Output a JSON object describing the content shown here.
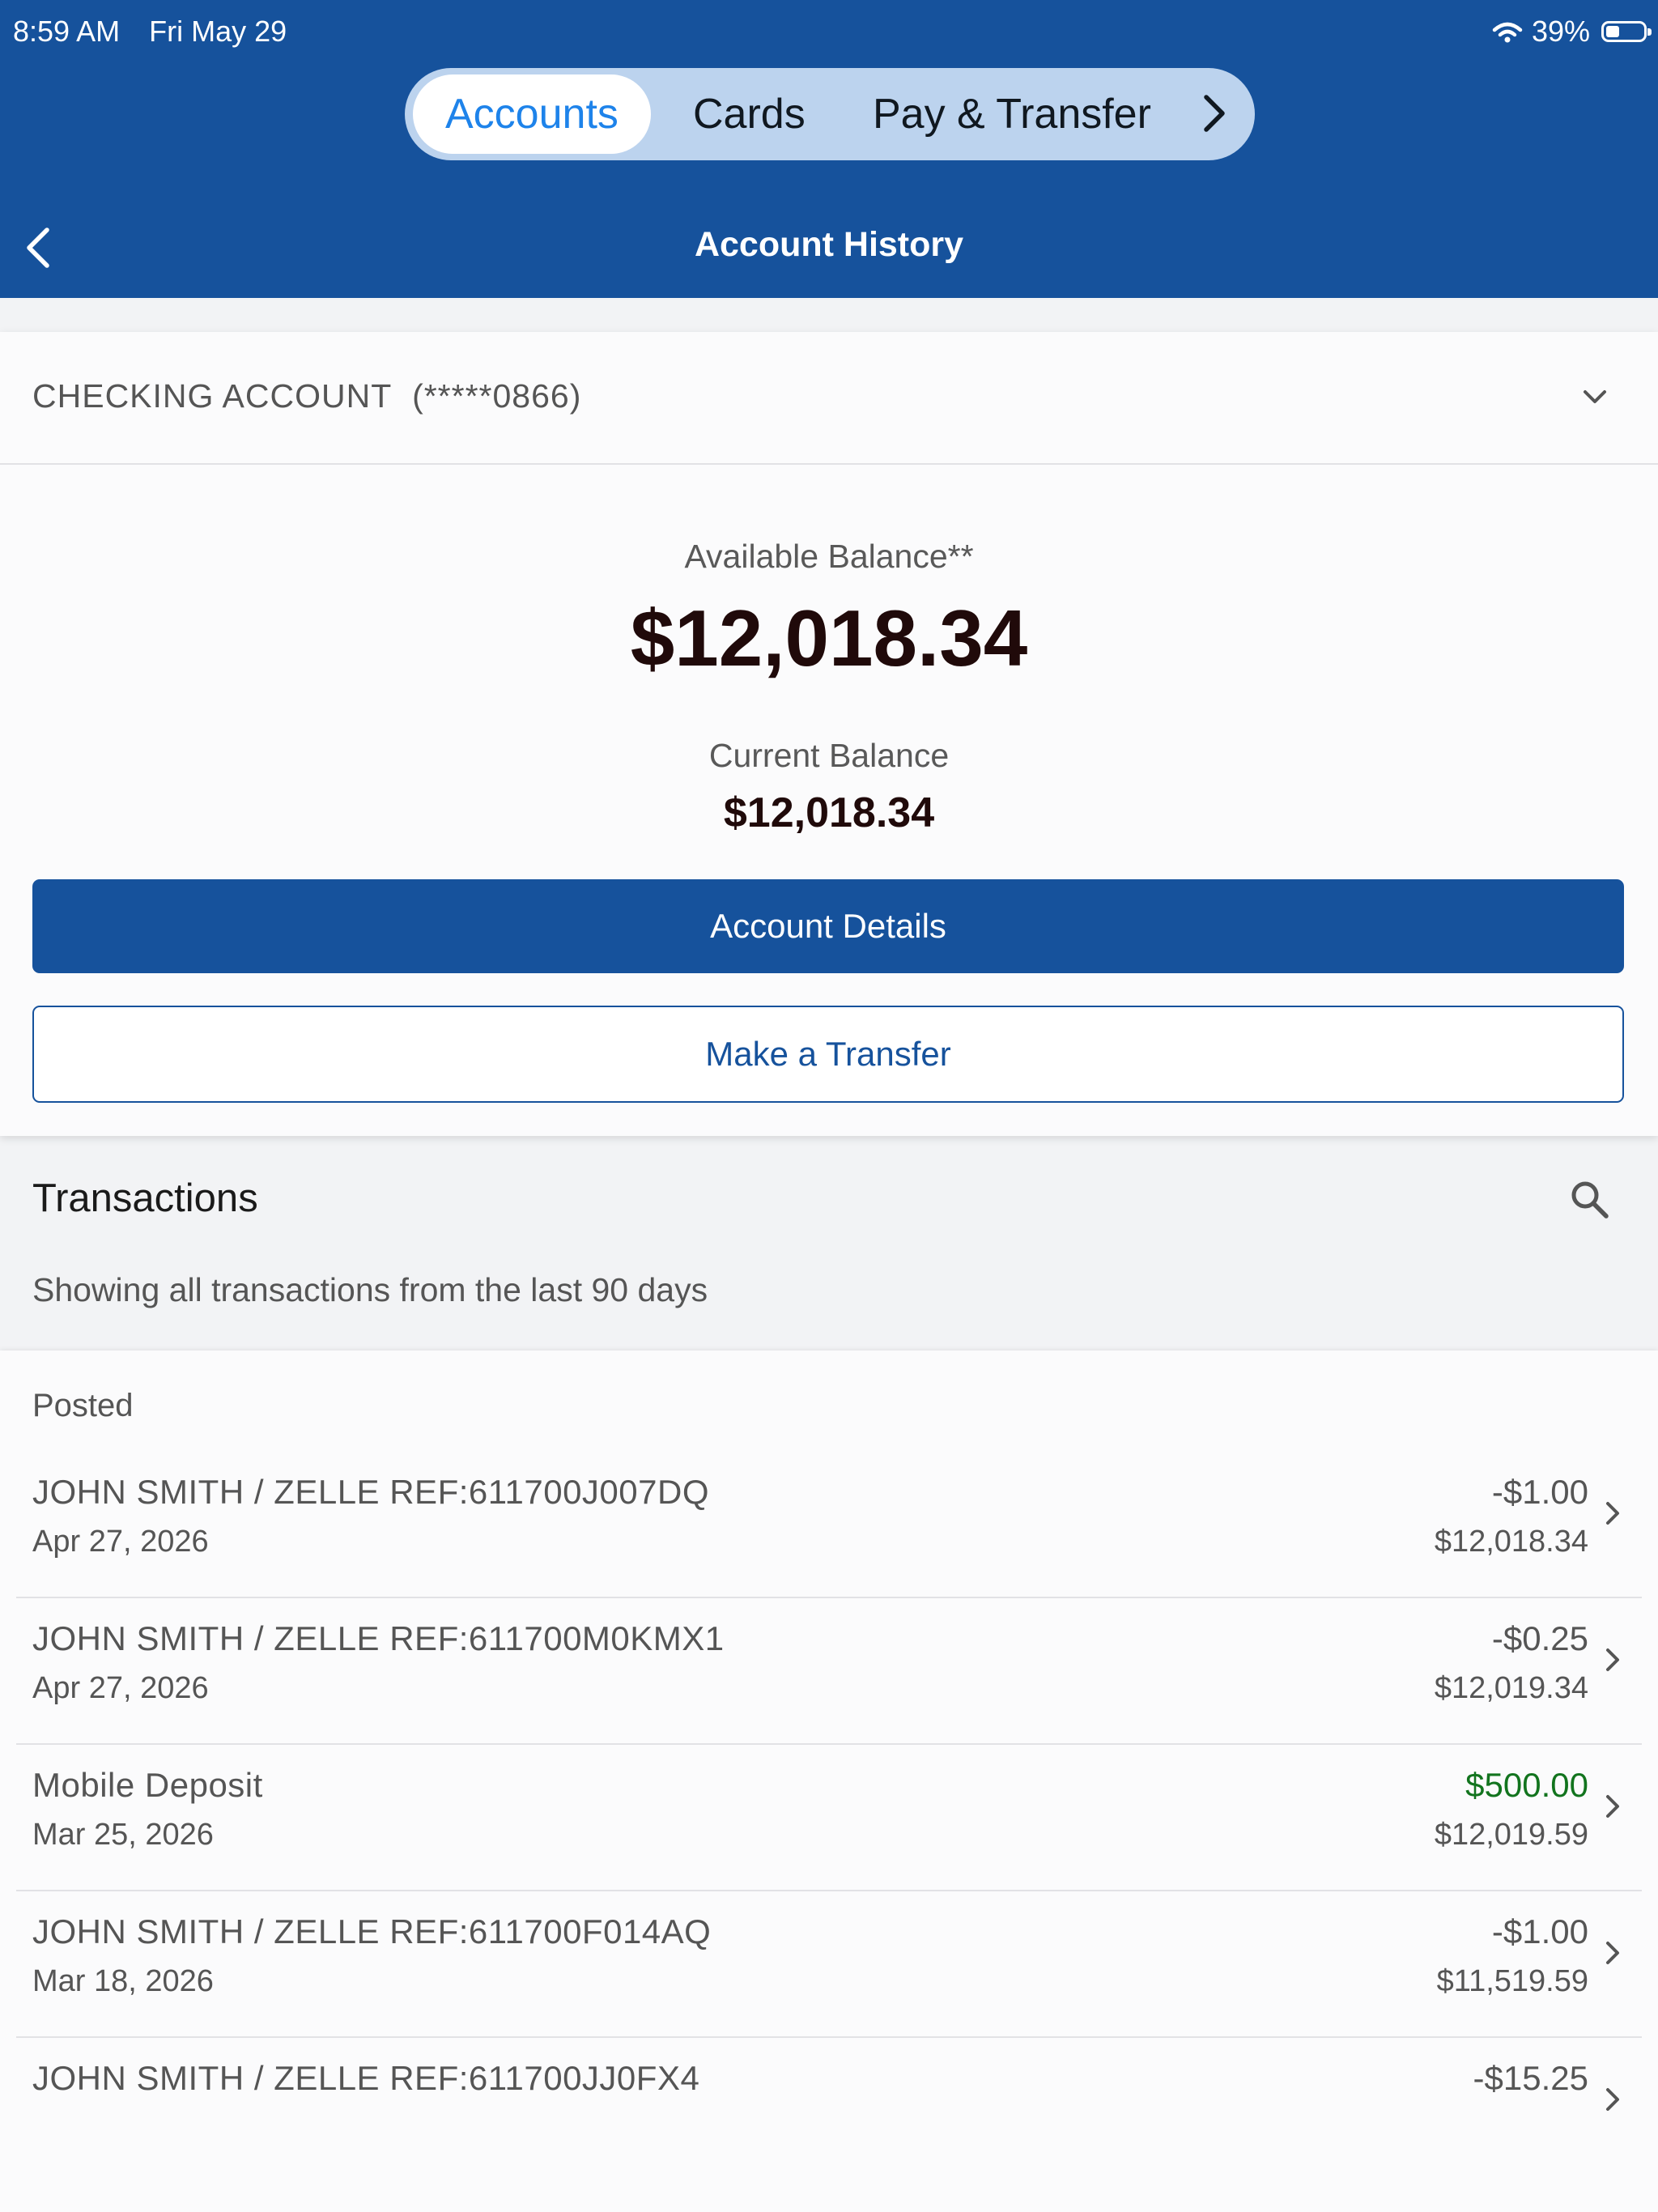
{
  "status_bar": {
    "time": "8:59 AM",
    "date": "Fri May 29",
    "battery": "39%"
  },
  "tabs": [
    {
      "label": "Accounts",
      "active": true
    },
    {
      "label": "Cards",
      "active": false
    },
    {
      "label": "Pay & Transfer",
      "active": false
    }
  ],
  "header": {
    "title": "Account History"
  },
  "account": {
    "name": "CHECKING ACCOUNT",
    "number": "(*****0866)",
    "available_label": "Available Balance**",
    "available_balance": "$12,018.34",
    "current_label": "Current Balance",
    "current_balance": "$12,018.34",
    "details_button": "Account Details",
    "transfer_button": "Make a Transfer"
  },
  "transactions": {
    "title": "Transactions",
    "subtitle": "Showing all transactions from the last 90 days",
    "section_label": "Posted",
    "items": [
      {
        "description": "JOHN SMITH / ZELLE REF:611700J007DQ",
        "date": "Apr 27, 2026",
        "amount": "-$1.00",
        "balance": "$12,018.34"
      },
      {
        "description": "JOHN SMITH / ZELLE REF:611700M0KMX1",
        "date": "Apr 27, 2026",
        "amount": "-$0.25",
        "balance": "$12,019.34"
      },
      {
        "description": "Mobile Deposit",
        "date": "Mar 25, 2026",
        "amount": "$500.00",
        "balance": "$12,019.59"
      },
      {
        "description": "JOHN SMITH / ZELLE REF:611700F014AQ",
        "date": "Mar 18, 2026",
        "amount": "-$1.00",
        "balance": "$11,519.59"
      },
      {
        "description": "JOHN SMITH / ZELLE REF:611700JJ0FX4",
        "date": "",
        "amount": "-$15.25",
        "balance": ""
      }
    ]
  },
  "colors": {
    "brand": "#16529c",
    "tab_active_text": "#1e83ea",
    "positive_amount": "#12741e",
    "balance_text": "#200a0a"
  }
}
